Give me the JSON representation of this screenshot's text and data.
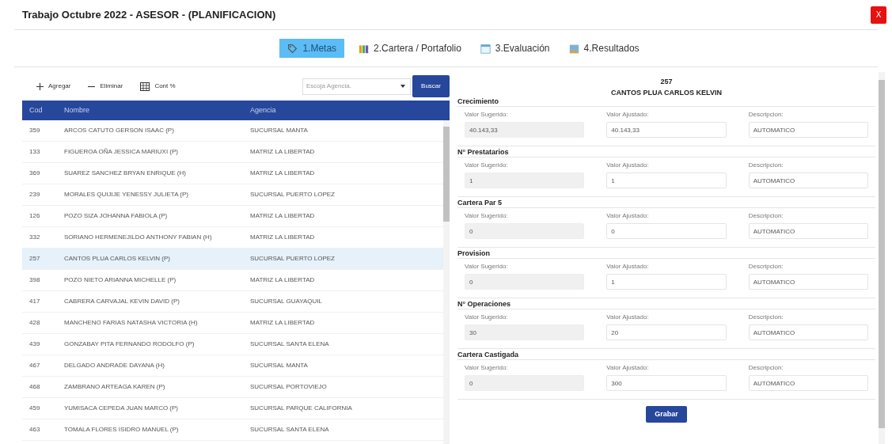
{
  "window": {
    "title": "Trabajo Octubre 2022 - ASESOR - (PLANIFICACION)",
    "close": "X"
  },
  "tabs": [
    {
      "label": "1.Metas",
      "kind": "tag",
      "selected": true
    },
    {
      "label": "2.Cartera / Portafolio",
      "kind": "bars",
      "selected": false
    },
    {
      "label": "3.Evaluación",
      "kind": "table",
      "selected": false
    },
    {
      "label": "4.Resultados",
      "kind": "image",
      "selected": false
    }
  ],
  "toolbar": [
    {
      "label": "Agregar",
      "kind": "plus"
    },
    {
      "label": "Eliminar",
      "kind": "minus"
    },
    {
      "label": "Cont %",
      "kind": "grid"
    }
  ],
  "agency_select": {
    "placeholder": "Escoja Agencia."
  },
  "search_button": "Buscar",
  "table": {
    "columns": [
      "Cod",
      "Nombre",
      "Agencia"
    ],
    "rows": [
      {
        "cod": "359",
        "nombre": "ARCOS CATUTO GERSON ISAAC (P)",
        "agencia": "SUCURSAL MANTA",
        "selected": false
      },
      {
        "cod": "133",
        "nombre": "FIGUEROA OÑA JESSICA MARIUXI (P)",
        "agencia": "MATRIZ LA LIBERTAD",
        "selected": false
      },
      {
        "cod": "369",
        "nombre": "SUAREZ SANCHEZ BRYAN ENRIQUE (H)",
        "agencia": "MATRIZ LA LIBERTAD",
        "selected": false
      },
      {
        "cod": "239",
        "nombre": "MORALES QUIJIJE YENESSY JULIETA (P)",
        "agencia": "SUCURSAL PUERTO LOPEZ",
        "selected": false
      },
      {
        "cod": "126",
        "nombre": "POZO SIZA JOHANNA FABIOLA (P)",
        "agencia": "MATRIZ LA LIBERTAD",
        "selected": false
      },
      {
        "cod": "332",
        "nombre": "SORIANO HERMENEJILDO ANTHONY FABIAN (H)",
        "agencia": "MATRIZ LA LIBERTAD",
        "selected": false
      },
      {
        "cod": "257",
        "nombre": "CANTOS PLUA CARLOS KELVIN (P)",
        "agencia": "SUCURSAL PUERTO LOPEZ",
        "selected": true
      },
      {
        "cod": "398",
        "nombre": "POZO NIETO ARIANNA MICHELLE (P)",
        "agencia": "MATRIZ LA LIBERTAD",
        "selected": false
      },
      {
        "cod": "417",
        "nombre": "CABRERA CARVAJAL KEVIN DAVID (P)",
        "agencia": "SUCURSAL GUAYAQUIL",
        "selected": false
      },
      {
        "cod": "428",
        "nombre": "MANCHENO FARIAS NATASHA VICTORIA (H)",
        "agencia": "MATRIZ LA LIBERTAD",
        "selected": false
      },
      {
        "cod": "439",
        "nombre": "GONZABAY PITA FERNANDO RODOLFO (P)",
        "agencia": "SUCURSAL SANTA ELENA",
        "selected": false
      },
      {
        "cod": "467",
        "nombre": "DELGADO ANDRADE DAYANA (H)",
        "agencia": "SUCURSAL MANTA",
        "selected": false
      },
      {
        "cod": "468",
        "nombre": "ZAMBRANO ARTEAGA KAREN (P)",
        "agencia": "SUCURSAL PORTOVIEJO",
        "selected": false
      },
      {
        "cod": "459",
        "nombre": "YUMISACA CEPEDA JUAN MARCO (P)",
        "agencia": "SUCURSAL PARQUE CALIFORNIA",
        "selected": false
      },
      {
        "cod": "463",
        "nombre": "TOMALA FLORES ISIDRO MANUEL (P)",
        "agencia": "SUCURSAL SANTA ELENA",
        "selected": false
      }
    ]
  },
  "detail": {
    "cod": "257",
    "name": "CANTOS PLUA CARLOS KELVIN",
    "sections": [
      {
        "title": "Crecimiento",
        "fields": [
          {
            "label": "Valor Sugerido:",
            "value": "40.143,33",
            "readonly": true
          },
          {
            "label": "Valor Ajustado:",
            "value": "40.143,33",
            "readonly": false
          },
          {
            "label": "Descripcion:",
            "value": "AUTOMATICO",
            "readonly": false
          }
        ]
      },
      {
        "title": "N° Prestatarios",
        "fields": [
          {
            "label": "Valor Sugerido:",
            "value": "1",
            "readonly": true
          },
          {
            "label": "Valor Ajustado:",
            "value": "1",
            "readonly": false
          },
          {
            "label": "Descripcion:",
            "value": "AUTOMATICO",
            "readonly": false
          }
        ]
      },
      {
        "title": "Cartera Par 5",
        "fields": [
          {
            "label": "Valor Sugerido:",
            "value": "0",
            "readonly": true
          },
          {
            "label": "Valor Ajustado:",
            "value": "0",
            "readonly": false
          },
          {
            "label": "Descripcion:",
            "value": "AUTOMATICO",
            "readonly": false
          }
        ]
      },
      {
        "title": "Provision",
        "fields": [
          {
            "label": "Valor Sugerido:",
            "value": "0",
            "readonly": true
          },
          {
            "label": "Valor Ajustado:",
            "value": "1",
            "readonly": false
          },
          {
            "label": "Descripcion:",
            "value": "AUTOMATICO",
            "readonly": false
          }
        ]
      },
      {
        "title": "N° Operaciones",
        "fields": [
          {
            "label": "Valor Sugerido:",
            "value": "30",
            "readonly": true
          },
          {
            "label": "Valor Ajustado:",
            "value": "20",
            "readonly": false
          },
          {
            "label": "Descripcion:",
            "value": "AUTOMATICO",
            "readonly": false
          }
        ]
      },
      {
        "title": "Cartera Castigada",
        "fields": [
          {
            "label": "Valor Sugerido:",
            "value": "0",
            "readonly": true
          },
          {
            "label": "Valor Ajustado:",
            "value": "300",
            "readonly": false
          },
          {
            "label": "Descripcion:",
            "value": "AUTOMATICO",
            "readonly": false
          }
        ]
      }
    ],
    "save_button": "Grabar"
  }
}
